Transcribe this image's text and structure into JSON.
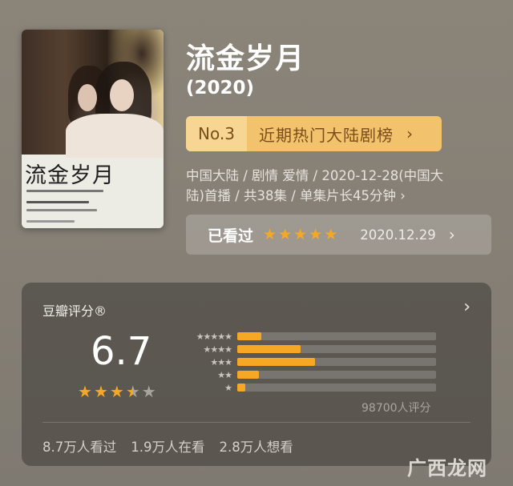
{
  "movie": {
    "title": "流金岁月",
    "year": "(2020)",
    "poster_title": "流金岁月"
  },
  "rank": {
    "number": "No.3",
    "list_name": "近期热门大陆剧榜",
    "chevron": "›"
  },
  "meta": {
    "line1": "中国大陆 / 剧情 爱情 / 2020-12-28(中国大",
    "line2": "陆)首播 / 共38集 / 单集片长45分钟 ›"
  },
  "watched": {
    "label": "已看过",
    "stars": 5,
    "date": "2020.12.29",
    "chevron": "›"
  },
  "rating": {
    "section_title": "豆瓣评分®",
    "chevron": "›",
    "score": "6.7",
    "stars_value": 3.5,
    "distribution": [
      {
        "stars": "★★★★★",
        "value": 0.12
      },
      {
        "stars": "★★★★",
        "value": 0.32
      },
      {
        "stars": "★★★",
        "value": 0.39
      },
      {
        "stars": "★★",
        "value": 0.11
      },
      {
        "stars": "★",
        "value": 0.04
      }
    ],
    "raters": "98700人评分",
    "stats": [
      "8.7万人看过",
      "1.9万人在看",
      "2.8万人想看"
    ]
  },
  "watermark": "广西龙网",
  "colors": {
    "accent_star": "#f6a825",
    "rank_bg": "#f3c26c",
    "rank_text": "#7a4e1a"
  }
}
